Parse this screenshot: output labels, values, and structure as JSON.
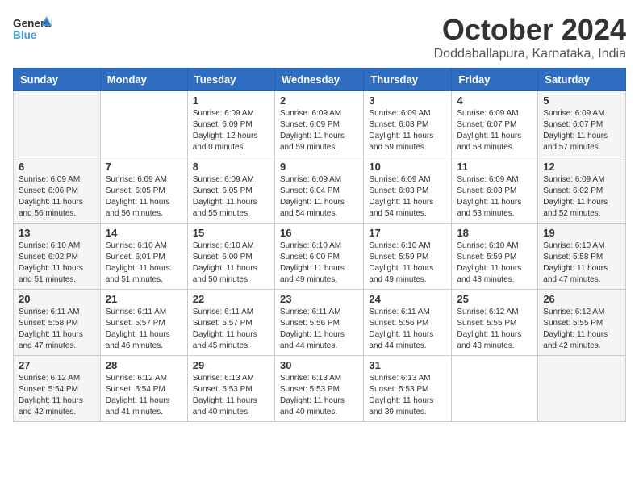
{
  "header": {
    "logo": {
      "general": "General",
      "blue": "Blue"
    },
    "title": "October 2024",
    "location": "Doddaballapura, Karnataka, India"
  },
  "weekdays": [
    "Sunday",
    "Monday",
    "Tuesday",
    "Wednesday",
    "Thursday",
    "Friday",
    "Saturday"
  ],
  "weeks": [
    [
      {
        "day": "",
        "sunrise": "",
        "sunset": "",
        "daylight": ""
      },
      {
        "day": "",
        "sunrise": "",
        "sunset": "",
        "daylight": ""
      },
      {
        "day": "1",
        "sunrise": "Sunrise: 6:09 AM",
        "sunset": "Sunset: 6:09 PM",
        "daylight": "Daylight: 12 hours and 0 minutes."
      },
      {
        "day": "2",
        "sunrise": "Sunrise: 6:09 AM",
        "sunset": "Sunset: 6:09 PM",
        "daylight": "Daylight: 11 hours and 59 minutes."
      },
      {
        "day": "3",
        "sunrise": "Sunrise: 6:09 AM",
        "sunset": "Sunset: 6:08 PM",
        "daylight": "Daylight: 11 hours and 59 minutes."
      },
      {
        "day": "4",
        "sunrise": "Sunrise: 6:09 AM",
        "sunset": "Sunset: 6:07 PM",
        "daylight": "Daylight: 11 hours and 58 minutes."
      },
      {
        "day": "5",
        "sunrise": "Sunrise: 6:09 AM",
        "sunset": "Sunset: 6:07 PM",
        "daylight": "Daylight: 11 hours and 57 minutes."
      }
    ],
    [
      {
        "day": "6",
        "sunrise": "Sunrise: 6:09 AM",
        "sunset": "Sunset: 6:06 PM",
        "daylight": "Daylight: 11 hours and 56 minutes."
      },
      {
        "day": "7",
        "sunrise": "Sunrise: 6:09 AM",
        "sunset": "Sunset: 6:05 PM",
        "daylight": "Daylight: 11 hours and 56 minutes."
      },
      {
        "day": "8",
        "sunrise": "Sunrise: 6:09 AM",
        "sunset": "Sunset: 6:05 PM",
        "daylight": "Daylight: 11 hours and 55 minutes."
      },
      {
        "day": "9",
        "sunrise": "Sunrise: 6:09 AM",
        "sunset": "Sunset: 6:04 PM",
        "daylight": "Daylight: 11 hours and 54 minutes."
      },
      {
        "day": "10",
        "sunrise": "Sunrise: 6:09 AM",
        "sunset": "Sunset: 6:03 PM",
        "daylight": "Daylight: 11 hours and 54 minutes."
      },
      {
        "day": "11",
        "sunrise": "Sunrise: 6:09 AM",
        "sunset": "Sunset: 6:03 PM",
        "daylight": "Daylight: 11 hours and 53 minutes."
      },
      {
        "day": "12",
        "sunrise": "Sunrise: 6:09 AM",
        "sunset": "Sunset: 6:02 PM",
        "daylight": "Daylight: 11 hours and 52 minutes."
      }
    ],
    [
      {
        "day": "13",
        "sunrise": "Sunrise: 6:10 AM",
        "sunset": "Sunset: 6:02 PM",
        "daylight": "Daylight: 11 hours and 51 minutes."
      },
      {
        "day": "14",
        "sunrise": "Sunrise: 6:10 AM",
        "sunset": "Sunset: 6:01 PM",
        "daylight": "Daylight: 11 hours and 51 minutes."
      },
      {
        "day": "15",
        "sunrise": "Sunrise: 6:10 AM",
        "sunset": "Sunset: 6:00 PM",
        "daylight": "Daylight: 11 hours and 50 minutes."
      },
      {
        "day": "16",
        "sunrise": "Sunrise: 6:10 AM",
        "sunset": "Sunset: 6:00 PM",
        "daylight": "Daylight: 11 hours and 49 minutes."
      },
      {
        "day": "17",
        "sunrise": "Sunrise: 6:10 AM",
        "sunset": "Sunset: 5:59 PM",
        "daylight": "Daylight: 11 hours and 49 minutes."
      },
      {
        "day": "18",
        "sunrise": "Sunrise: 6:10 AM",
        "sunset": "Sunset: 5:59 PM",
        "daylight": "Daylight: 11 hours and 48 minutes."
      },
      {
        "day": "19",
        "sunrise": "Sunrise: 6:10 AM",
        "sunset": "Sunset: 5:58 PM",
        "daylight": "Daylight: 11 hours and 47 minutes."
      }
    ],
    [
      {
        "day": "20",
        "sunrise": "Sunrise: 6:11 AM",
        "sunset": "Sunset: 5:58 PM",
        "daylight": "Daylight: 11 hours and 47 minutes."
      },
      {
        "day": "21",
        "sunrise": "Sunrise: 6:11 AM",
        "sunset": "Sunset: 5:57 PM",
        "daylight": "Daylight: 11 hours and 46 minutes."
      },
      {
        "day": "22",
        "sunrise": "Sunrise: 6:11 AM",
        "sunset": "Sunset: 5:57 PM",
        "daylight": "Daylight: 11 hours and 45 minutes."
      },
      {
        "day": "23",
        "sunrise": "Sunrise: 6:11 AM",
        "sunset": "Sunset: 5:56 PM",
        "daylight": "Daylight: 11 hours and 44 minutes."
      },
      {
        "day": "24",
        "sunrise": "Sunrise: 6:11 AM",
        "sunset": "Sunset: 5:56 PM",
        "daylight": "Daylight: 11 hours and 44 minutes."
      },
      {
        "day": "25",
        "sunrise": "Sunrise: 6:12 AM",
        "sunset": "Sunset: 5:55 PM",
        "daylight": "Daylight: 11 hours and 43 minutes."
      },
      {
        "day": "26",
        "sunrise": "Sunrise: 6:12 AM",
        "sunset": "Sunset: 5:55 PM",
        "daylight": "Daylight: 11 hours and 42 minutes."
      }
    ],
    [
      {
        "day": "27",
        "sunrise": "Sunrise: 6:12 AM",
        "sunset": "Sunset: 5:54 PM",
        "daylight": "Daylight: 11 hours and 42 minutes."
      },
      {
        "day": "28",
        "sunrise": "Sunrise: 6:12 AM",
        "sunset": "Sunset: 5:54 PM",
        "daylight": "Daylight: 11 hours and 41 minutes."
      },
      {
        "day": "29",
        "sunrise": "Sunrise: 6:13 AM",
        "sunset": "Sunset: 5:53 PM",
        "daylight": "Daylight: 11 hours and 40 minutes."
      },
      {
        "day": "30",
        "sunrise": "Sunrise: 6:13 AM",
        "sunset": "Sunset: 5:53 PM",
        "daylight": "Daylight: 11 hours and 40 minutes."
      },
      {
        "day": "31",
        "sunrise": "Sunrise: 6:13 AM",
        "sunset": "Sunset: 5:53 PM",
        "daylight": "Daylight: 11 hours and 39 minutes."
      },
      {
        "day": "",
        "sunrise": "",
        "sunset": "",
        "daylight": ""
      },
      {
        "day": "",
        "sunrise": "",
        "sunset": "",
        "daylight": ""
      }
    ]
  ]
}
